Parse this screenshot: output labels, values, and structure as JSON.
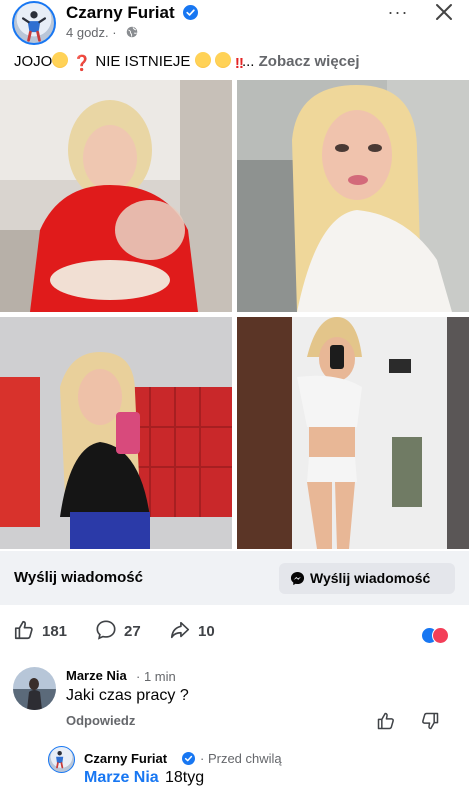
{
  "post": {
    "author": "Czarny Furiat",
    "time": "4 godz. ·",
    "more": "···",
    "text_prefix": "JOJO",
    "text_middle": " NIE ISTNIEJE ",
    "text_ellipsis": "... ",
    "see_more": "Zobacz więcej"
  },
  "message_bar": {
    "label": "Wyślij wiadomość",
    "button_label": "Wyślij wiadomość"
  },
  "reactions": {
    "likes": "181",
    "comments": "27",
    "shares": "10"
  },
  "comment": {
    "author": "Marze Nia",
    "time": "· 1 min",
    "text": "Jaki czas pracy ?",
    "reply_label": "Odpowiedz"
  },
  "reply": {
    "author": "Czarny Furiat",
    "time": "· Przed chwilą",
    "mention": "Marze Nia",
    "text": "18tyg"
  },
  "icons": {
    "verified": "verified-badge-icon",
    "globe": "globe-icon",
    "close": "close-icon",
    "messenger": "messenger-icon",
    "like": "thumbs-up-icon",
    "comment": "comment-bubble-icon",
    "share": "share-arrow-icon",
    "dislike": "thumbs-down-icon"
  },
  "colors": {
    "accent": "#1877f2",
    "bar_bg": "#f0f2f5",
    "muted": "#65676b",
    "love": "#f33e58"
  }
}
